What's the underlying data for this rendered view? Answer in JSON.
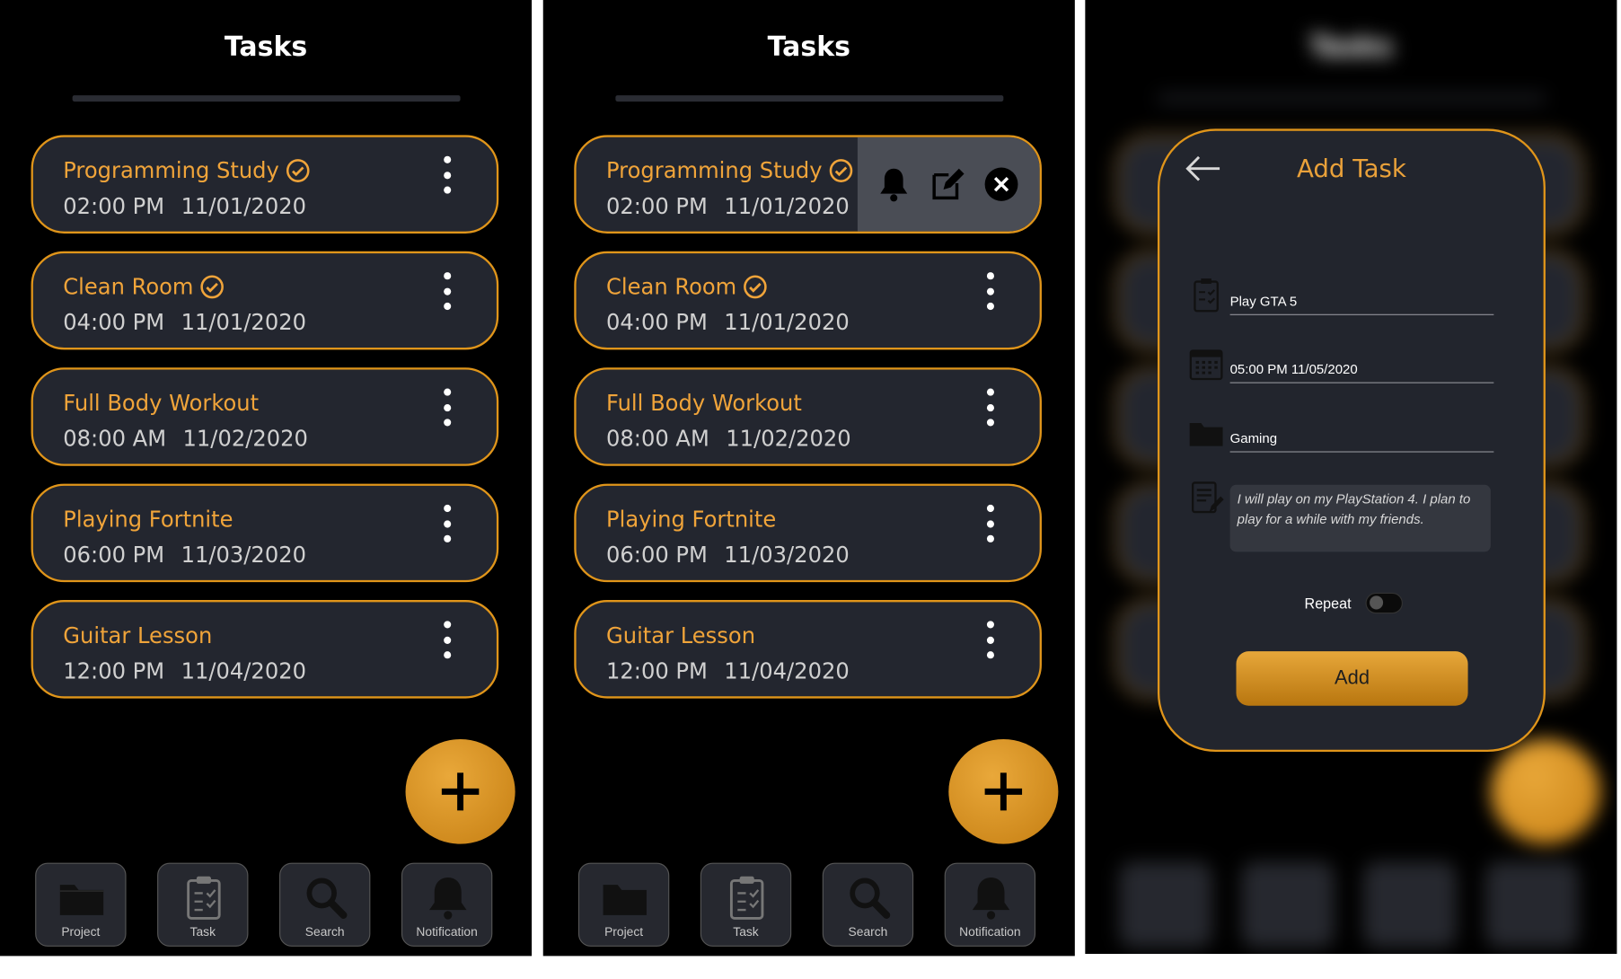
{
  "app_title": "Tasks",
  "tasks": [
    {
      "name": "Programming Study",
      "time": "02:00 PM",
      "date": "11/01/2020",
      "done": true
    },
    {
      "name": "Clean Room",
      "time": "04:00 PM",
      "date": "11/01/2020",
      "done": true
    },
    {
      "name": "Full Body Workout",
      "time": "08:00 AM",
      "date": "11/02/2020",
      "done": false
    },
    {
      "name": "Playing Fortnite",
      "time": "06:00 PM",
      "date": "11/03/2020",
      "done": false
    },
    {
      "name": "Guitar Lesson",
      "time": "12:00 PM",
      "date": "11/04/2020",
      "done": false
    }
  ],
  "nav": [
    {
      "label": "Project",
      "icon": "folder-icon"
    },
    {
      "label": "Task",
      "icon": "clipboard-icon"
    },
    {
      "label": "Search",
      "icon": "search-icon"
    },
    {
      "label": "Notification",
      "icon": "bell-icon"
    }
  ],
  "swipe_actions": [
    "bell-icon",
    "edit-icon",
    "close-icon"
  ],
  "add_task": {
    "title": "Add Task",
    "task_name": "Play GTA 5",
    "datetime": "05:00 PM 11/05/2020",
    "project": "Gaming",
    "notes": "I will play on my PlayStation 4. I plan to play for a while with my friends.",
    "repeat_label": "Repeat",
    "repeat_on": false,
    "add_label": "Add"
  },
  "colors": {
    "accent": "#e0951a",
    "card_bg": "#23262f",
    "screen_bg": "#000000"
  }
}
